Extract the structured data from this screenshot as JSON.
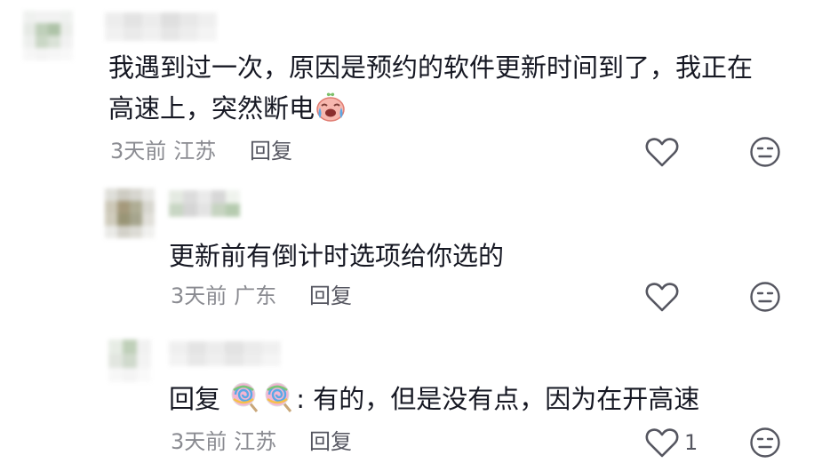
{
  "comments": [
    {
      "text_line1": "我遇到过一次，原因是预约的软件更新时间到了，我正在",
      "text_line2": "高速上，突然断电",
      "emoji": "crying-face-emoji",
      "time": "3天前",
      "location": "江苏",
      "reply_label": "回复",
      "like_icon": "heart-outline-icon",
      "dislike_icon": "meh-face-icon"
    }
  ],
  "replies": [
    {
      "text": "更新前有倒计时选项给你选的",
      "time": "3天前",
      "location": "广东",
      "reply_label": "回复",
      "like_icon": "heart-outline-icon",
      "dislike_icon": "meh-face-icon"
    },
    {
      "reply_prefix": "回复",
      "mention_emoji": "lollipop-emoji",
      "text": ": 有的，但是没有点，因为在开高速",
      "time": "3天前",
      "location": "江苏",
      "reply_label": "回复",
      "like_count": "1",
      "like_icon": "heart-outline-icon",
      "dislike_icon": "meh-face-icon"
    }
  ],
  "colors": {
    "text_primary": "#161823",
    "text_meta": "#8a8b91",
    "icon_stroke": "#555660",
    "emoji_pink": "#f5a9a5",
    "emoji_tear": "#5aa9e6"
  }
}
